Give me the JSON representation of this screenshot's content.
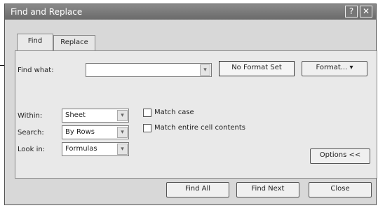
{
  "dialog": {
    "title": "Find and Replace",
    "help_glyph": "?",
    "close_glyph": "✕"
  },
  "tabs": [
    {
      "label": "Find"
    },
    {
      "label": "Replace"
    }
  ],
  "find": {
    "label": "Find what:",
    "value": "",
    "no_format": "No Format Set",
    "format_button": "Format... ▾"
  },
  "options": {
    "within_label": "Within:",
    "within_value": "Sheet",
    "search_label": "Search:",
    "search_value": "By Rows",
    "lookin_label": "Look in:",
    "lookin_value": "Formulas",
    "match_case": "Match case",
    "match_entire": "Match entire cell contents",
    "options_button": "Options <<"
  },
  "buttons": {
    "find_all": "Find All",
    "find_next": "Find Next",
    "close": "Close"
  },
  "icons": {
    "dropdown": "▾"
  }
}
